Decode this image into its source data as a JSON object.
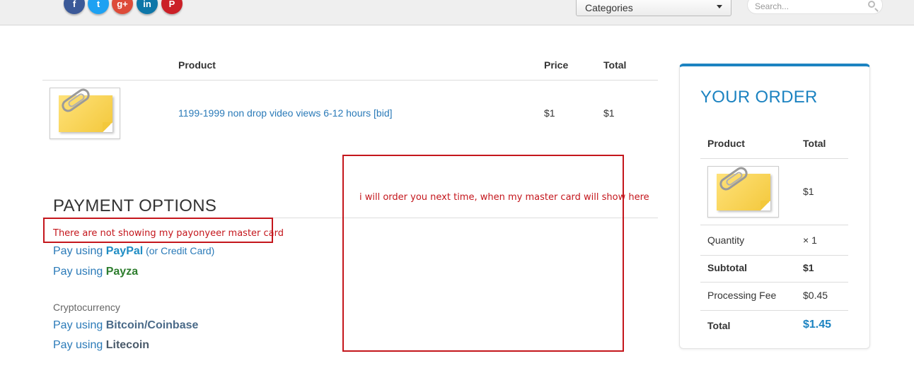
{
  "header": {
    "social": [
      {
        "label": "f",
        "color": "#3b5998"
      },
      {
        "label": "t",
        "color": "#1da1f2"
      },
      {
        "label": "g+",
        "color": "#dd4b39"
      },
      {
        "label": "in",
        "color": "#0e76a8"
      },
      {
        "label": "P",
        "color": "#cb2027"
      }
    ],
    "categories_label": "Categories",
    "search_placeholder": "Search..."
  },
  "cart": {
    "columns": {
      "product": "Product",
      "price": "Price",
      "total": "Total"
    },
    "items": [
      {
        "name": "1199-1999 non drop video views 6-12 hours [bid]",
        "price": "$1",
        "total": "$1"
      }
    ]
  },
  "payment": {
    "title": "PAYMENT OPTIONS",
    "paypal": {
      "prefix": "Pay using ",
      "brand": "PayPal",
      "suffix": " (or Credit Card)"
    },
    "payza": {
      "prefix": "Pay using ",
      "brand": "Payza"
    },
    "crypto_label": "Cryptocurrency",
    "bitcoin": {
      "prefix": "Pay using ",
      "brand": "Bitcoin/Coinbase"
    },
    "litecoin": {
      "prefix": "Pay using ",
      "brand": "Litecoin"
    }
  },
  "order": {
    "title": "YOUR ORDER",
    "col_product": "Product",
    "col_total": "Total",
    "item_total": "$1",
    "quantity_label": "Quantity",
    "quantity_value": "× 1",
    "subtotal_label": "Subtotal",
    "subtotal_value": "$1",
    "fee_label": "Processing Fee",
    "fee_value": "$0.45",
    "total_label": "Total",
    "total_value": "$1.45"
  },
  "annotations": {
    "left_note": "There are not showing my payonyeer master card",
    "right_note": "i will order you next time, when my master card will show here",
    "color": "#c4161c"
  }
}
